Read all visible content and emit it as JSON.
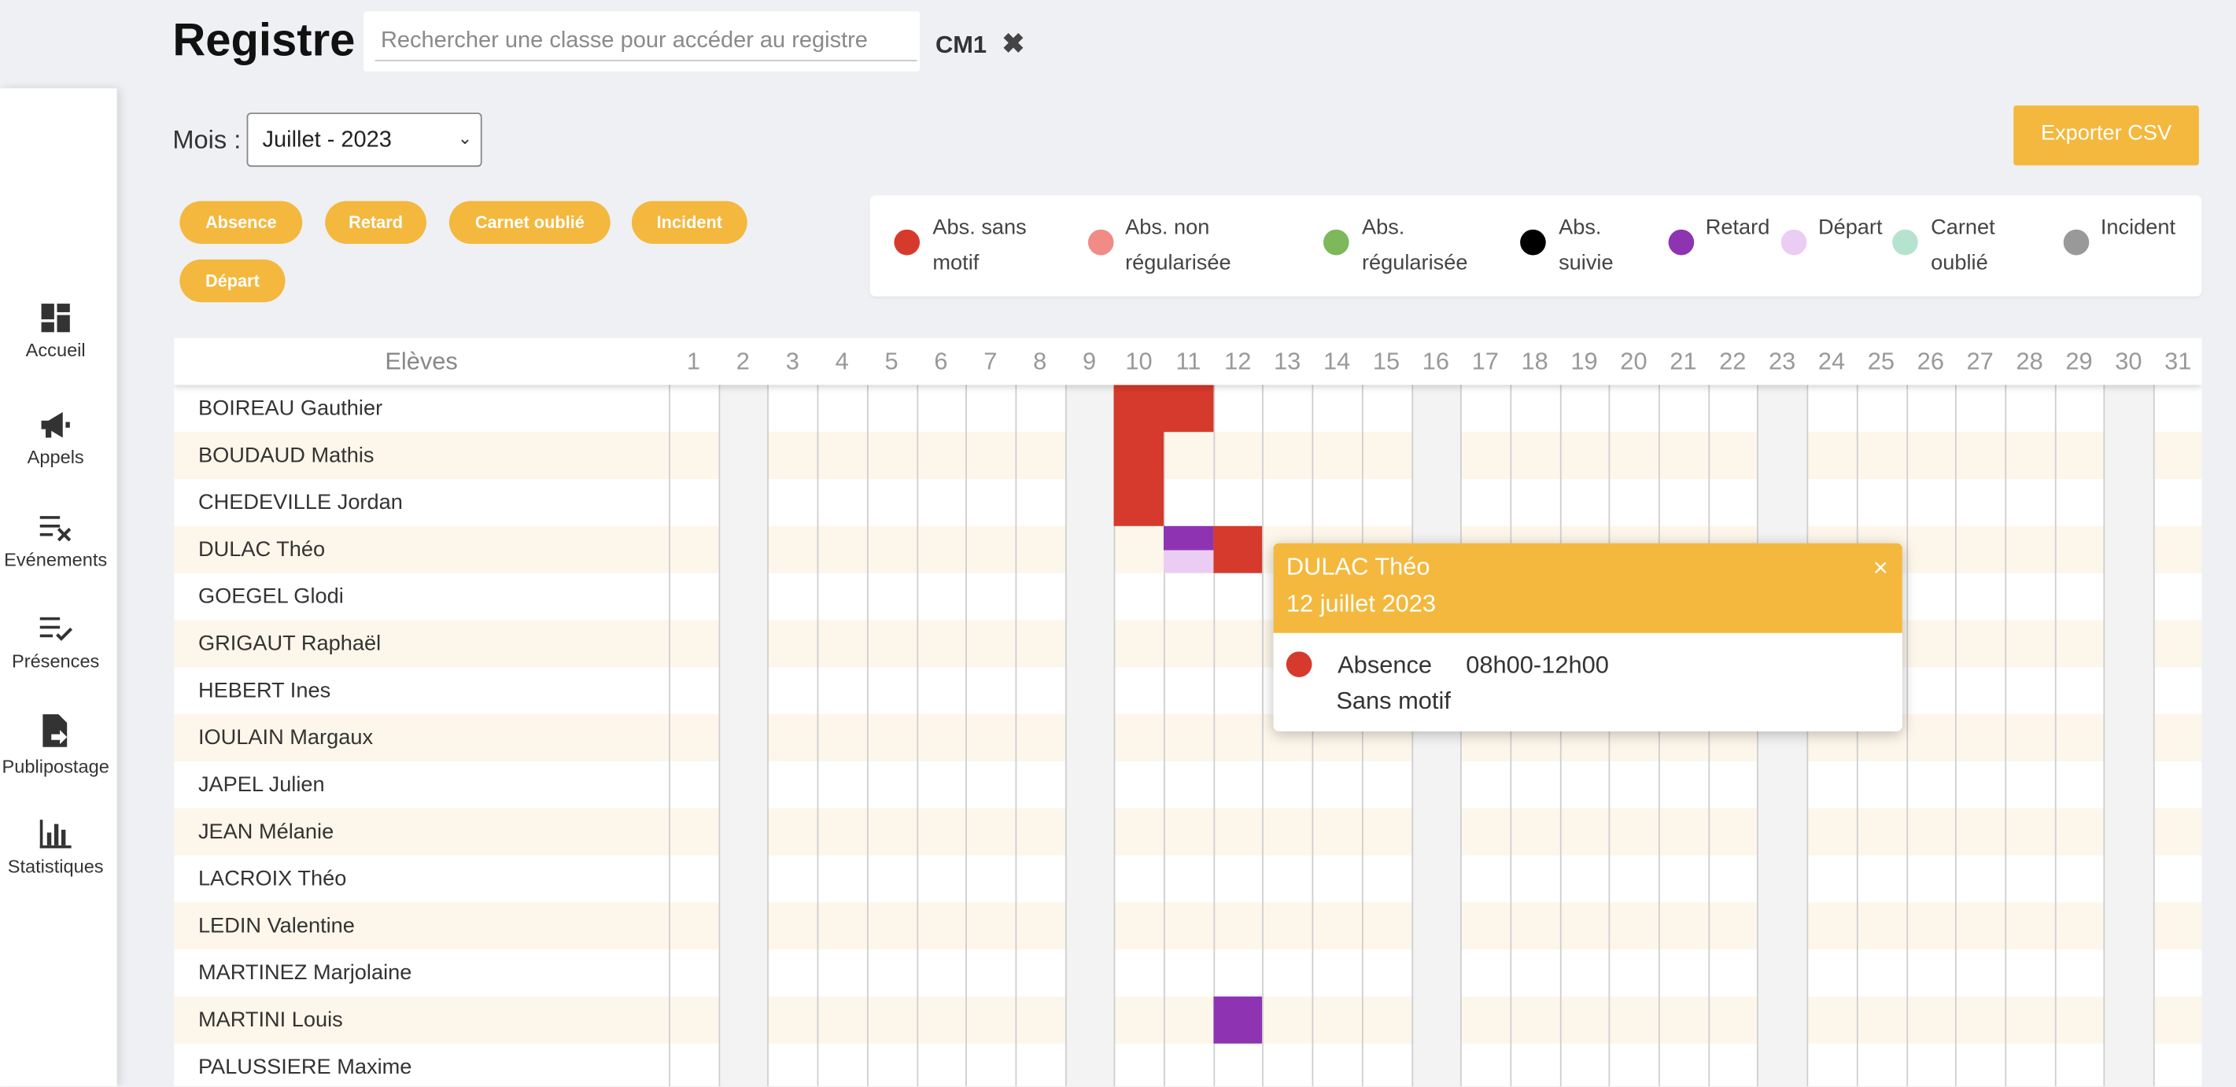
{
  "header": {
    "title": "Registre",
    "search_placeholder": "Rechercher une classe pour accéder au registre",
    "class_chip": "CM1",
    "class_chip_remove": "✖"
  },
  "sidebar": {
    "items": [
      {
        "label": "Accueil",
        "icon": "dashboard-icon"
      },
      {
        "label": "Appels",
        "icon": "megaphone-icon"
      },
      {
        "label": "Evénements",
        "icon": "events-list-icon"
      },
      {
        "label": "Présences",
        "icon": "attendance-check-icon"
      },
      {
        "label": "Publipostage",
        "icon": "mail-merge-icon"
      },
      {
        "label": "Statistiques",
        "icon": "bar-chart-icon"
      }
    ]
  },
  "filters": {
    "mois_label": "Mois :",
    "mois_value": "Juillet - 2023",
    "export_label": "Exporter CSV",
    "event_buttons": [
      "Absence",
      "Retard",
      "Carnet oublié",
      "Incident",
      "Départ"
    ]
  },
  "legend": {
    "items": [
      {
        "label_1": "Abs. sans",
        "label_2": "motif",
        "color": "#d63a2c"
      },
      {
        "label_1": "Abs. non",
        "label_2": "régularisée",
        "color": "#f08b86"
      },
      {
        "label_1": "Abs.",
        "label_2": "régularisée",
        "color": "#7db85a"
      },
      {
        "label_1": "Abs.",
        "label_2": "suivie",
        "color": "#000000"
      },
      {
        "label_1": "Retard",
        "label_2": "",
        "color": "#8e34b3"
      },
      {
        "label_1": "Départ",
        "label_2": "",
        "color": "#ebcdf3"
      },
      {
        "label_1": "Carnet",
        "label_2": "oublié",
        "color": "#b5e3d0"
      },
      {
        "label_1": "Incident",
        "label_2": "",
        "color": "#999999"
      }
    ]
  },
  "grid": {
    "eleves_header": "Elèves",
    "days": [
      "1",
      "2",
      "3",
      "4",
      "5",
      "6",
      "7",
      "8",
      "9",
      "10",
      "11",
      "12",
      "13",
      "14",
      "15",
      "16",
      "17",
      "18",
      "19",
      "20",
      "21",
      "22",
      "23",
      "24",
      "25",
      "26",
      "27",
      "28",
      "29",
      "30",
      "31"
    ],
    "weekend_days": [
      2,
      9,
      16,
      23,
      30
    ],
    "students": [
      "BOIREAU Gauthier",
      "BOUDAUD Mathis",
      "CHEDEVILLE Jordan",
      "DULAC Théo",
      "GOEGEL Glodi",
      "GRIGAUT Raphaël",
      "HEBERT Ines",
      "IOULAIN Margaux",
      "JAPEL Julien",
      "JEAN Mélanie",
      "LACROIX Théo",
      "LEDIN Valentine",
      "MARTINEZ Marjolaine",
      "MARTINI Louis",
      "PALUSSIERE Maxime"
    ],
    "marks": [
      {
        "student": 0,
        "day": 10,
        "span": 3,
        "part": "full",
        "color": "#d63a2c"
      },
      {
        "student": 0,
        "day": 11,
        "span": 1,
        "part": "full",
        "color": "#d63a2c"
      },
      {
        "student": 3,
        "day": 11,
        "span": 1,
        "part": "top",
        "color": "#8e34b3"
      },
      {
        "student": 3,
        "day": 11,
        "span": 1,
        "part": "bottom",
        "color": "#ebcdf3"
      },
      {
        "student": 3,
        "day": 12,
        "span": 1,
        "part": "full",
        "color": "#d63a2c"
      },
      {
        "student": 13,
        "day": 12,
        "span": 1,
        "part": "full",
        "color": "#8e34b3"
      }
    ]
  },
  "popup": {
    "name": "DULAC Théo",
    "date": "12 juillet 2023",
    "close": "×",
    "event_type": "Absence",
    "time": "08h00-12h00",
    "motif": "Sans motif",
    "dot_color": "#d63a2c"
  }
}
